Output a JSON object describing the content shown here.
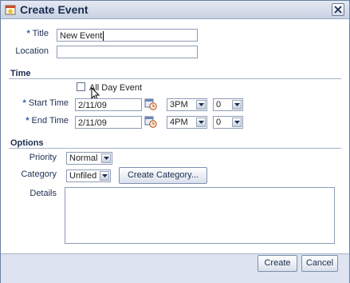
{
  "dialog": {
    "title": "Create Event",
    "icon": "calendar-star-icon"
  },
  "form": {
    "title_label": "Title",
    "title_value": "New Event",
    "location_label": "Location",
    "location_value": "",
    "time_section": "Time",
    "all_day_label": "All Day Event",
    "all_day_checked": false,
    "start_label": "Start Time",
    "start_date": "2/11/09",
    "start_hour": "3PM",
    "start_minute": "0",
    "end_label": "End Time",
    "end_date": "2/11/09",
    "end_hour": "4PM",
    "end_minute": "0",
    "options_section": "Options",
    "priority_label": "Priority",
    "priority_value": "Normal",
    "category_label": "Category",
    "category_value": "Unfiled",
    "create_category_label": "Create Category...",
    "details_label": "Details",
    "details_value": "",
    "required_marker": "*"
  },
  "footer": {
    "create_label": "Create",
    "cancel_label": "Cancel"
  },
  "colors": {
    "accent": "#2d5bb5",
    "titlebar": "#c9d3e3",
    "footer": "#dde4ef"
  }
}
